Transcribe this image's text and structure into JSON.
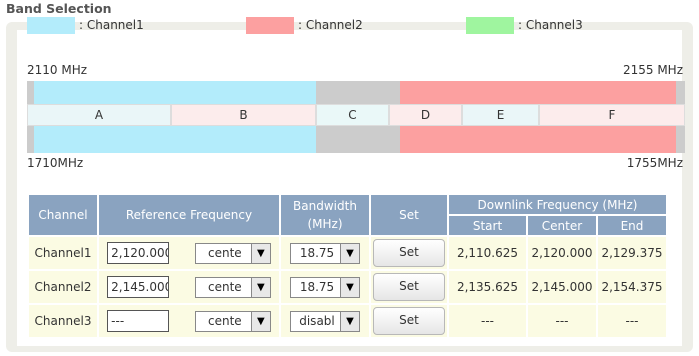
{
  "title": "Band Selection",
  "legend": [
    {
      "label": ": Channel1",
      "color": "#b3ecfb"
    },
    {
      "label": ": Channel2",
      "color": "#fca0a0"
    },
    {
      "label": ": Channel3",
      "color": "#9ff59f"
    }
  ],
  "downlink_start": "2110 MHz",
  "downlink_end": "2155 MHz",
  "uplink_start": "1710MHz",
  "uplink_end": "1755MHz",
  "bands": [
    "A",
    "B",
    "C",
    "D",
    "E",
    "F"
  ],
  "table": {
    "headers": {
      "channel": "Channel",
      "ref_freq": "Reference Frequency",
      "bandwidth": "Bandwidth (MHz)",
      "set": "Set",
      "downlink": "Downlink Frequency (MHz)",
      "start": "Start",
      "center": "Center",
      "end": "End"
    },
    "rows": [
      {
        "channel": "Channel1",
        "ref": "2,120.000",
        "ref_mode": "cente",
        "bw": "18.75",
        "set": "Set",
        "start": "2,110.625",
        "center": "2,120.000",
        "end": "2,129.375"
      },
      {
        "channel": "Channel2",
        "ref": "2,145.000",
        "ref_mode": "cente",
        "bw": "18.75",
        "set": "Set",
        "start": "2,135.625",
        "center": "2,145.000",
        "end": "2,154.375"
      },
      {
        "channel": "Channel3",
        "ref": "---",
        "ref_mode": "cente",
        "bw": "disabl",
        "set": "Set",
        "start": "---",
        "center": "---",
        "end": "---"
      }
    ]
  }
}
